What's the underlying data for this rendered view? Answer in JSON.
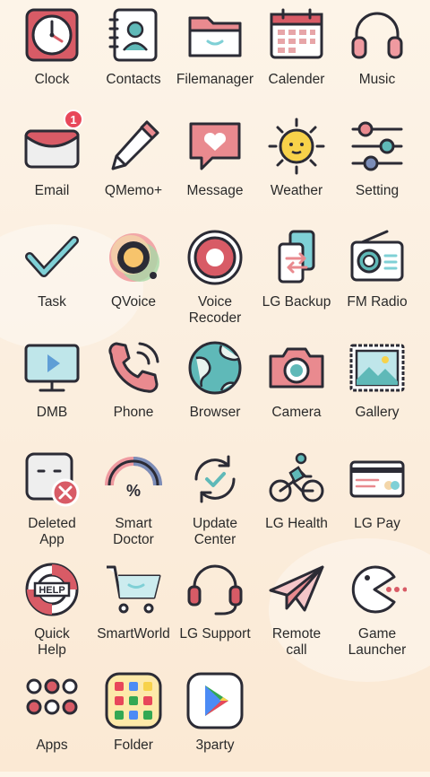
{
  "apps": [
    {
      "label": "Clock",
      "icon": "clock-icon"
    },
    {
      "label": "Contacts",
      "icon": "contacts-icon"
    },
    {
      "label": "Filemanager",
      "icon": "folder-icon"
    },
    {
      "label": "Calender",
      "icon": "calendar-icon"
    },
    {
      "label": "Music",
      "icon": "headphones-icon"
    },
    {
      "label": "Email",
      "icon": "envelope-icon",
      "badge": "1"
    },
    {
      "label": "QMemo+",
      "icon": "pencil-icon"
    },
    {
      "label": "Message",
      "icon": "heart-message-icon"
    },
    {
      "label": "Weather",
      "icon": "sun-icon"
    },
    {
      "label": "Setting",
      "icon": "sliders-icon"
    },
    {
      "label": "Task",
      "icon": "checkmark-icon"
    },
    {
      "label": "QVoice",
      "icon": "qvoice-icon"
    },
    {
      "label": "Voice\nRecoder",
      "icon": "record-icon"
    },
    {
      "label": "LG Backup",
      "icon": "backup-icon"
    },
    {
      "label": "FM Radio",
      "icon": "radio-icon"
    },
    {
      "label": "DMB",
      "icon": "tv-play-icon"
    },
    {
      "label": "Phone",
      "icon": "phone-icon"
    },
    {
      "label": "Browser",
      "icon": "globe-icon"
    },
    {
      "label": "Camera",
      "icon": "camera-icon"
    },
    {
      "label": "Gallery",
      "icon": "picture-icon"
    },
    {
      "label": "Deleted\nApp",
      "icon": "deleted-app-icon"
    },
    {
      "label": "Smart\nDoctor",
      "icon": "gauge-icon"
    },
    {
      "label": "Update\nCenter",
      "icon": "update-icon"
    },
    {
      "label": "LG Health",
      "icon": "cyclist-icon"
    },
    {
      "label": "LG Pay",
      "icon": "credit-card-icon"
    },
    {
      "label": "Quick\nHelp",
      "icon": "lifebuoy-help-icon"
    },
    {
      "label": "SmartWorld",
      "icon": "shopping-cart-icon"
    },
    {
      "label": "LG Support",
      "icon": "headset-icon"
    },
    {
      "label": "Remote\ncall",
      "icon": "paper-plane-icon"
    },
    {
      "label": "Game\nLauncher",
      "icon": "pacman-icon"
    },
    {
      "label": "Apps",
      "icon": "dots-grid-icon"
    },
    {
      "label": "Folder",
      "icon": "folder-apps-icon"
    },
    {
      "label": "3party",
      "icon": "play-store-icon"
    }
  ],
  "badge_color": "#e8475a",
  "accent_pink": "#e98a8f",
  "accent_teal": "#7fd0d6",
  "outline": "#2b2b35"
}
